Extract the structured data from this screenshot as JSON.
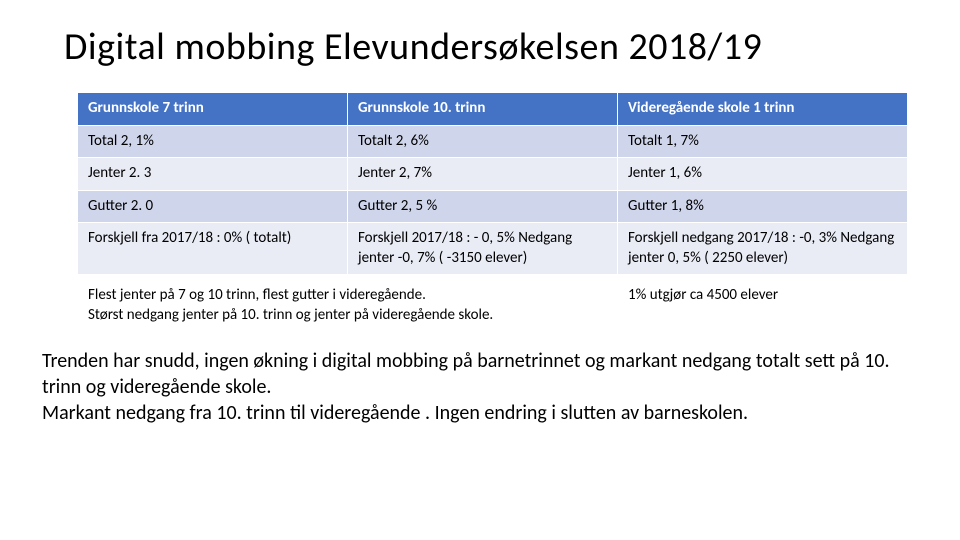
{
  "title": "Digital mobbing Elevundersøkelsen 2018/19",
  "table": {
    "headers": [
      "Grunnskole 7 trinn",
      "Grunnskole 10. trinn",
      "Videregående skole 1 trinn"
    ],
    "rows": [
      [
        "Total 2, 1%",
        "Totalt 2, 6%",
        "Totalt 1, 7%"
      ],
      [
        "Jenter 2. 3",
        "Jenter 2, 7%",
        "Jenter 1, 6%"
      ],
      [
        "Gutter 2. 0",
        "Gutter 2, 5 %",
        "Gutter 1, 8%"
      ],
      [
        "Forskjell fra 2017/18 : 0% ( totalt)",
        "Forskjell 2017/18 : - 0, 5% Nedgang jenter -0, 7% ( -3150 elever)",
        "Forskjell nedgang 2017/18 : -0, 3% Nedgang jenter 0, 5% ( 2250 elever)"
      ]
    ]
  },
  "footnote_left": "Flest jenter på 7 og 10 trinn, flest gutter i videregående.\nStørst nedgang jenter på 10. trinn og jenter på videregående skole.",
  "footnote_right": "1% utgjør ca 4500 elever",
  "body": "Trenden har snudd, ingen økning i digital mobbing på barnetrinnet og markant nedgang totalt sett på 10. trinn og videregående skole.\nMarkant nedgang fra 10. trinn til videregående . Ingen endring i slutten av barneskolen."
}
